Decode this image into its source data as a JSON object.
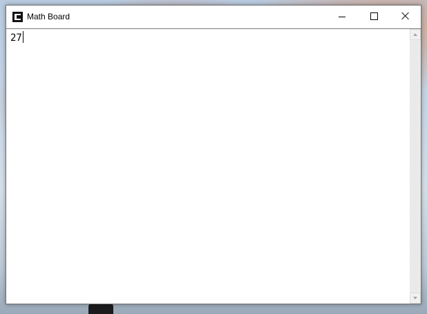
{
  "window": {
    "title": "Math Board",
    "app_icon": "math-board-app-icon",
    "controls": {
      "minimize_icon": "minimize-icon",
      "maximize_icon": "maximize-icon",
      "close_icon": "close-icon"
    }
  },
  "editor": {
    "text": "27"
  },
  "scrollbar": {
    "up_icon": "arrow-up-icon",
    "down_icon": "arrow-down-icon"
  },
  "colors": {
    "window_background": "#ffffff",
    "titlebar_text": "#000000",
    "scrollbar_track": "#f0f0f0"
  }
}
